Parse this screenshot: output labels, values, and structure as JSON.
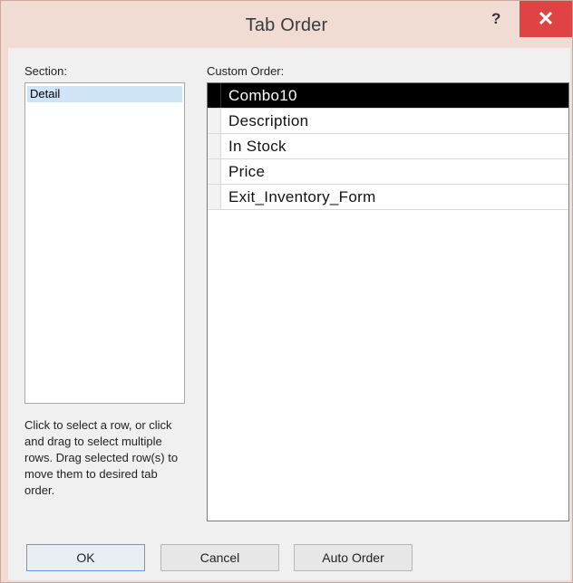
{
  "dialog": {
    "title": "Tab Order",
    "help_glyph": "?",
    "close_glyph": "✕"
  },
  "section": {
    "label": "Section:",
    "items": [
      "Detail"
    ],
    "selected": "Detail"
  },
  "hint": "Click to select a row, or click and drag to select multiple rows.  Drag selected row(s) to move them to desired tab order.",
  "custom_order": {
    "label": "Custom Order:",
    "rows": [
      "Combo10",
      "Description",
      "In Stock",
      "Price",
      "Exit_Inventory_Form"
    ],
    "selected_index": 0
  },
  "buttons": {
    "ok": "OK",
    "cancel": "Cancel",
    "auto_order": "Auto Order"
  },
  "colors": {
    "titlebar": "#f0dcd3",
    "close_bg": "#e04343",
    "selection_bg": "#cfe4f7",
    "row_selected_bg": "#000000"
  },
  "icons": {
    "help": "help-icon",
    "close": "close-icon"
  }
}
